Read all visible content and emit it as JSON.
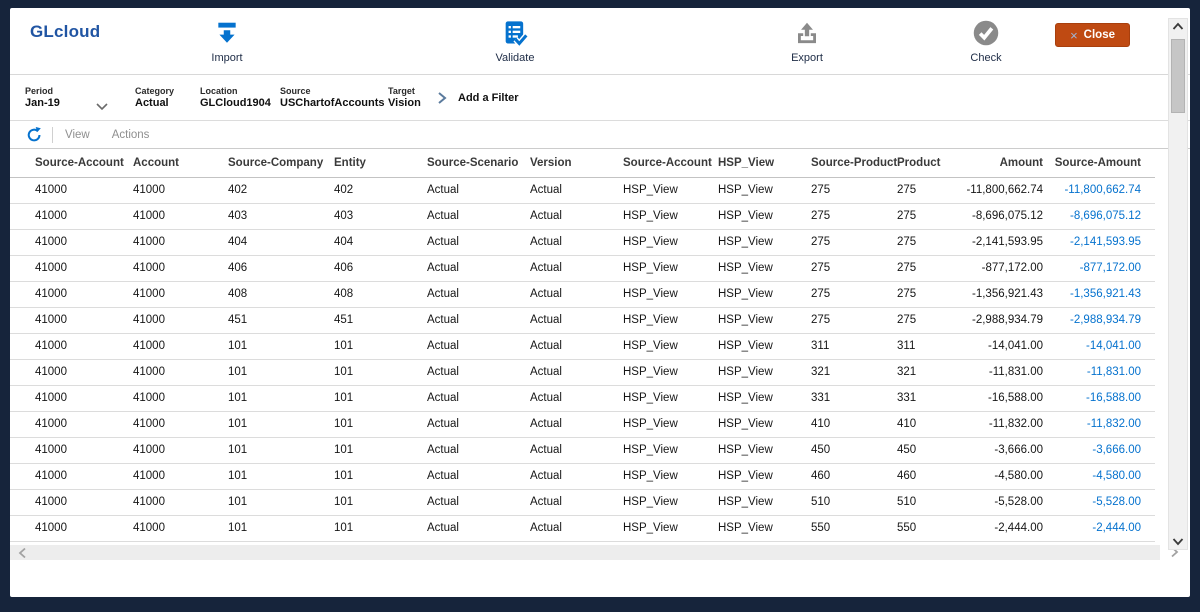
{
  "app": {
    "title": "GLcloud"
  },
  "toolbar": {
    "actions": [
      {
        "name": "import",
        "label": "Import"
      },
      {
        "name": "validate",
        "label": "Validate"
      },
      {
        "name": "export",
        "label": "Export"
      },
      {
        "name": "check",
        "label": "Check"
      }
    ],
    "close": {
      "label": "Close",
      "icon_char": "×"
    }
  },
  "filters": {
    "items": [
      {
        "label": "Period",
        "value": "Jan-19"
      },
      {
        "label": "Category",
        "value": "Actual"
      },
      {
        "label": "Location",
        "value": "GLCloud1904"
      },
      {
        "label": "Source",
        "value": "USChartofAccounts"
      },
      {
        "label": "Target",
        "value": "Vision"
      }
    ],
    "add_filter_label": "Add a Filter"
  },
  "view_bar": {
    "view_label": "View",
    "actions_label": "Actions"
  },
  "table": {
    "columns": [
      {
        "label": "Source-Account",
        "align": "left"
      },
      {
        "label": "Account",
        "align": "left"
      },
      {
        "label": "Source-Company",
        "align": "left"
      },
      {
        "label": "Entity",
        "align": "left"
      },
      {
        "label": "Source-Scenario",
        "align": "left"
      },
      {
        "label": "Version",
        "align": "left"
      },
      {
        "label": "Source-Account",
        "align": "left"
      },
      {
        "label": "HSP_View",
        "align": "left"
      },
      {
        "label": "Source-Product",
        "align": "left"
      },
      {
        "label": "Product",
        "align": "left"
      },
      {
        "label": "Amount",
        "align": "right"
      },
      {
        "label": "Source-Amount",
        "align": "right",
        "value_color": "#0572CE"
      }
    ],
    "rows": [
      [
        "41000",
        "41000",
        "402",
        "402",
        "Actual",
        "Actual",
        "HSP_View",
        "HSP_View",
        "275",
        "275",
        "-11,800,662.74",
        "-11,800,662.74"
      ],
      [
        "41000",
        "41000",
        "403",
        "403",
        "Actual",
        "Actual",
        "HSP_View",
        "HSP_View",
        "275",
        "275",
        "-8,696,075.12",
        "-8,696,075.12"
      ],
      [
        "41000",
        "41000",
        "404",
        "404",
        "Actual",
        "Actual",
        "HSP_View",
        "HSP_View",
        "275",
        "275",
        "-2,141,593.95",
        "-2,141,593.95"
      ],
      [
        "41000",
        "41000",
        "406",
        "406",
        "Actual",
        "Actual",
        "HSP_View",
        "HSP_View",
        "275",
        "275",
        "-877,172.00",
        "-877,172.00"
      ],
      [
        "41000",
        "41000",
        "408",
        "408",
        "Actual",
        "Actual",
        "HSP_View",
        "HSP_View",
        "275",
        "275",
        "-1,356,921.43",
        "-1,356,921.43"
      ],
      [
        "41000",
        "41000",
        "451",
        "451",
        "Actual",
        "Actual",
        "HSP_View",
        "HSP_View",
        "275",
        "275",
        "-2,988,934.79",
        "-2,988,934.79"
      ],
      [
        "41000",
        "41000",
        "101",
        "101",
        "Actual",
        "Actual",
        "HSP_View",
        "HSP_View",
        "311",
        "311",
        "-14,041.00",
        "-14,041.00"
      ],
      [
        "41000",
        "41000",
        "101",
        "101",
        "Actual",
        "Actual",
        "HSP_View",
        "HSP_View",
        "321",
        "321",
        "-11,831.00",
        "-11,831.00"
      ],
      [
        "41000",
        "41000",
        "101",
        "101",
        "Actual",
        "Actual",
        "HSP_View",
        "HSP_View",
        "331",
        "331",
        "-16,588.00",
        "-16,588.00"
      ],
      [
        "41000",
        "41000",
        "101",
        "101",
        "Actual",
        "Actual",
        "HSP_View",
        "HSP_View",
        "410",
        "410",
        "-11,832.00",
        "-11,832.00"
      ],
      [
        "41000",
        "41000",
        "101",
        "101",
        "Actual",
        "Actual",
        "HSP_View",
        "HSP_View",
        "450",
        "450",
        "-3,666.00",
        "-3,666.00"
      ],
      [
        "41000",
        "41000",
        "101",
        "101",
        "Actual",
        "Actual",
        "HSP_View",
        "HSP_View",
        "460",
        "460",
        "-4,580.00",
        "-4,580.00"
      ],
      [
        "41000",
        "41000",
        "101",
        "101",
        "Actual",
        "Actual",
        "HSP_View",
        "HSP_View",
        "510",
        "510",
        "-5,528.00",
        "-5,528.00"
      ],
      [
        "41000",
        "41000",
        "101",
        "101",
        "Actual",
        "Actual",
        "HSP_View",
        "HSP_View",
        "550",
        "550",
        "-2,444.00",
        "-2,444.00"
      ]
    ]
  },
  "colors": {
    "brand_blue": "#2155A3",
    "icon_blue": "#0572CE",
    "icon_gray": "#8A8A8A",
    "close_orange": "#BF4A12",
    "amount_blue": "#0572CE",
    "frame_navy": "#16243B"
  }
}
